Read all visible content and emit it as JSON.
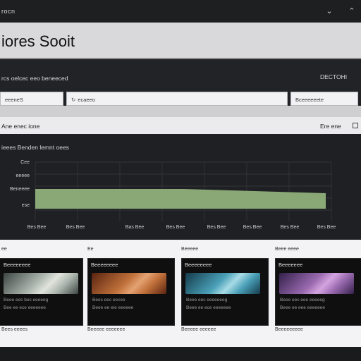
{
  "topbar": {
    "logo_text": "rocn",
    "icons": [
      "chevron-down-icon",
      "chevron-up-icon"
    ]
  },
  "title": {
    "text": "iores Sooit"
  },
  "filters": {
    "heading": "rcs oelcec eeo beneeced",
    "right_label": "DECTOHI",
    "field1_value": "eeeneS",
    "field2_value": "ecaeeo",
    "field3_value": "Bceeeeeete"
  },
  "section": {
    "label": "Ane enec ione",
    "right_label": "Ere ene"
  },
  "chart": {
    "title": "ieees Benden lemnt oees",
    "y_labels": [
      "Cee",
      "eeeee",
      "Beneeee",
      "ese"
    ],
    "x_labels": [
      "Bes Bee",
      "Bes Bee",
      "Bas Bee",
      "Bes Bee",
      "Bes Bee",
      "Bes Bee",
      "Bes Bee",
      "Bes Bee"
    ],
    "fill_color": "#8fb07a"
  },
  "cards": [
    {
      "caption": "ee",
      "title": "Beeeeeeee",
      "desc1": "Beee eec bec eeeeeg",
      "desc2": "Bee ee ece eeeeeee",
      "footer": "Bees eeees",
      "colors": [
        "#3c4442",
        "#aeb8b0",
        "#e0e4dc"
      ]
    },
    {
      "caption": "Ee",
      "title": "Beeeeeeee",
      "desc1": "Bees eec eecee",
      "desc2": "Beee ee eie eeeeee",
      "footer": "Beeeee eeeeeee",
      "colors": [
        "#5a2410",
        "#c0703a",
        "#e4a272"
      ]
    },
    {
      "caption": "Beeeee",
      "title": "Beeeeeeee",
      "desc1": "Beee eec eeeeeeeg",
      "desc2": "Beee ee ece eeeeeee",
      "footer": "Beeeee eeeeee",
      "colors": [
        "#143a4a",
        "#4aa0b8",
        "#a8dbe6"
      ]
    },
    {
      "caption": "Beee eeee",
      "title": "Beeeeeee",
      "desc1": "Beee eec eee eeeeeg",
      "desc2": "Beee ee eee eeeeeee",
      "footer": "Beeeeeeeee",
      "colors": [
        "#33204a",
        "#9a6ab0",
        "#d4a4e0"
      ]
    }
  ]
}
